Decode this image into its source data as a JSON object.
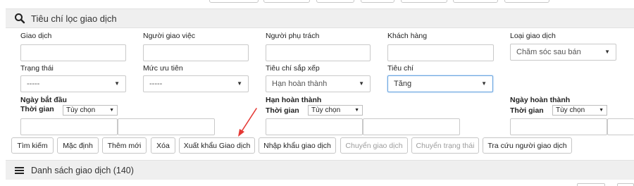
{
  "filter_panel": {
    "title": "Tiêu chí lọc giao dịch",
    "row1": {
      "giao_dich_label": "Giao dịch",
      "nguoi_giao_viec_label": "Người giao việc",
      "nguoi_phu_trach_label": "Người phụ trách",
      "khach_hang_label": "Khách hàng",
      "loai_giao_dich_label": "Loại giao dịch",
      "loai_giao_dich_value": "Chăm sóc sau bán"
    },
    "row2": {
      "trang_thai_label": "Trạng thái",
      "trang_thai_value": "-----",
      "muc_uu_tien_label": "Mức ưu tiên",
      "muc_uu_tien_value": "-----",
      "tieu_chi_sap_xep_label": "Tiêu chí sắp xếp",
      "tieu_chi_sap_xep_value": "Hạn hoàn thành",
      "tieu_chi_label": "Tiêu chí",
      "tieu_chi_value": "Tăng"
    },
    "row3": {
      "ngay_bat_dau_label": "Ngày bắt đầu",
      "han_hoan_thanh_label": "Hạn hoàn thành",
      "ngay_hoan_thanh_label": "Ngày hoàn thành",
      "thoi_gian_label": "Thời gian",
      "tuy_chon_value": "Tùy chọn"
    },
    "buttons": {
      "tim_kiem": "Tìm kiếm",
      "mac_dinh": "Mặc định",
      "them_moi": "Thêm mới",
      "xoa": "Xóa",
      "xuat_khau": "Xuất khẩu Giao dịch",
      "nhap_khau": "Nhập khẩu giao dịch",
      "chuyen_giao_dich": "Chuyển giao dịch",
      "chuyen_trang_thai": "Chuyển trạng thái",
      "tra_cuu": "Tra cứu người giao dịch"
    }
  },
  "list_panel": {
    "title": "Danh sách giao dịch (140)"
  },
  "icons": {
    "filter_header": "search-icon",
    "list_header": "hamburger-icon",
    "select_caret": "▼"
  },
  "colors": {
    "annotation_arrow": "#e53935",
    "focus_border": "#66a3e0"
  }
}
